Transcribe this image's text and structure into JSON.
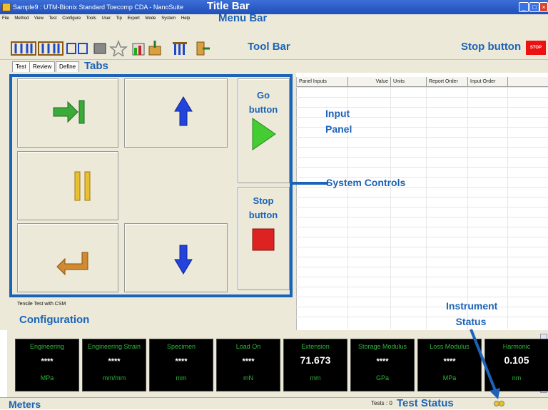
{
  "window": {
    "title": "Sample9 : UTM-Bionix Standard Toecomp CDA - NanoSuite"
  },
  "menu": [
    "File",
    "Method",
    "View",
    "Test",
    "Configure",
    "Tools",
    "User",
    "Tip",
    "Export",
    "Mode",
    "System",
    "Help"
  ],
  "toolbar": {
    "stop_label": "STOP"
  },
  "tabs": [
    "Test",
    "Review",
    "Define"
  ],
  "controls": {
    "go_label": "Go\nbutton",
    "stop_label": "Stop\nbutton"
  },
  "input_panel": {
    "columns": [
      "Panel Inputs",
      "Value",
      "Units",
      "Report Order",
      "Input Order"
    ]
  },
  "configuration": {
    "method_name": "Tensile Test with CSM"
  },
  "meters": [
    {
      "label": "Engineering",
      "value": "****",
      "unit": "MPa"
    },
    {
      "label": "Engineering Strain",
      "value": "****",
      "unit": "mm/mm"
    },
    {
      "label": "Specimen",
      "value": "****",
      "unit": "mm"
    },
    {
      "label": "Load On",
      "value": "****",
      "unit": "mN"
    },
    {
      "label": "Extension",
      "value": "71.673",
      "unit": "mm"
    },
    {
      "label": "Storage Modulus",
      "value": "****",
      "unit": "GPa"
    },
    {
      "label": "Loss Modulus",
      "value": "****",
      "unit": "MPa"
    },
    {
      "label": "Harmonic",
      "value": "0.105",
      "unit": "nm"
    }
  ],
  "status": {
    "tests_text": "Tests : 0"
  },
  "annotations": {
    "title_bar": "Title Bar",
    "menu_bar": "Menu Bar",
    "tool_bar": "Tool Bar",
    "stop_button": "Stop button",
    "tabs": "Tabs",
    "go_button": "Go button",
    "input_panel": "Input Panel",
    "system_controls": "System Controls",
    "stop_button_2": "Stop button",
    "configuration": "Configuration",
    "instrument_status": "Instrument Status",
    "meters": "Meters",
    "test_status": "Test Status"
  },
  "colors": {
    "annotation_blue": "#1b63b8",
    "stop_red": "#ee1111",
    "meter_green": "#2db83d",
    "go_green": "#44cc33"
  }
}
